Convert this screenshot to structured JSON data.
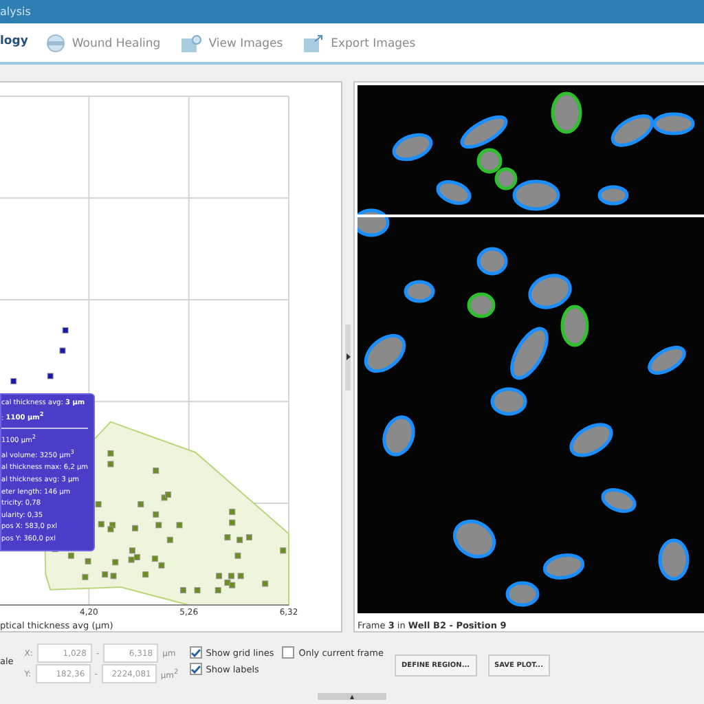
{
  "window": {
    "title": "alysis"
  },
  "tabs": [
    {
      "label": "logy",
      "selected": true
    },
    {
      "label": "Wound Healing",
      "selected": false
    },
    {
      "label": "View Images",
      "selected": false
    },
    {
      "label": "Export Images",
      "selected": false
    }
  ],
  "plot": {
    "xlabel": "ptical thickness avg (µm)",
    "xticks": [
      "4,20",
      "5,26",
      "6,32"
    ],
    "tooltip": {
      "header": [
        "cal thickness avg: **3 µm**",
        ": **1100 µm$^{2}$**"
      ],
      "lines": [
        "1100 µm$^{2}$",
        "al volume: 3250 µm$^{3}$",
        "al thickness max: 6,2 µm",
        "al thickness avg: 3 µm",
        "eter length: 146 µm",
        "tricity: 0,78",
        "ularity: 0,35",
        "pos X: 583,0 pxl",
        "pos Y: 360,0 pxl"
      ]
    }
  },
  "image_view": {
    "caption": "Frame **3** in **Well B2 - Position 9**"
  },
  "controls": {
    "scale_label": "ale",
    "x_range": {
      "label": "X:",
      "from": "1,028",
      "dash": "-",
      "to": "6,318",
      "unit": "µm"
    },
    "y_range": {
      "label": "Y:",
      "from": "182,36",
      "dash": "-",
      "to": "2224,081",
      "unit": "µm$^{2}$"
    },
    "checkboxes": [
      {
        "label": "Show grid lines",
        "checked": true
      },
      {
        "label": "Only current frame",
        "checked": false
      },
      {
        "label": "Show labels",
        "checked": true
      }
    ],
    "buttons": [
      "DEFINE REGION...",
      "SAVE PLOT..."
    ]
  },
  "grip": {
    "glyph": "▲"
  }
}
